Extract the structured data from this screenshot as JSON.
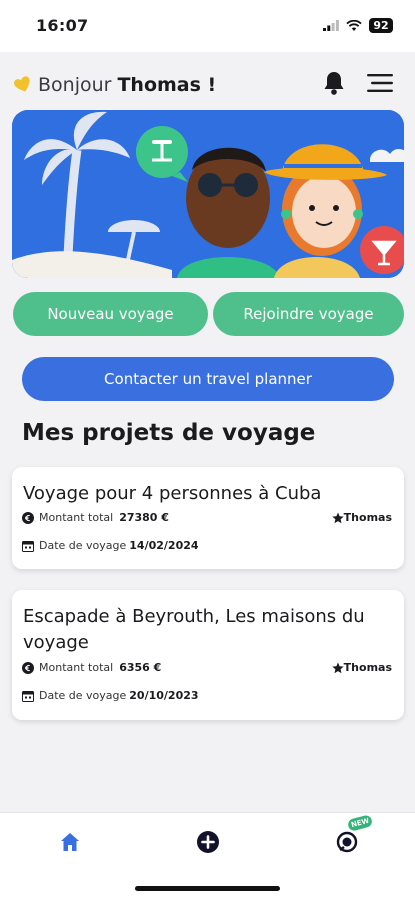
{
  "status": {
    "time": "16:07",
    "battery": "92"
  },
  "header": {
    "greeting": "Bonjour",
    "name": "Thomas !"
  },
  "actions": {
    "new_trip": "Nouveau voyage",
    "join_trip": "Rejoindre voyage",
    "contact_planner": "Contacter un travel planner"
  },
  "section_title": "Mes projets de voyage",
  "projects": [
    {
      "title": "Voyage pour 4 personnes à Cuba",
      "amount_label": "Montant total",
      "amount": "27380 €",
      "owner": "Thomas",
      "date_label": "Date de voyage",
      "date": "14/02/2024"
    },
    {
      "title": "Escapade à Beyrouth, Les maisons du voyage",
      "amount_label": "Montant total",
      "amount": "6356 €",
      "owner": "Thomas",
      "date_label": "Date de voyage",
      "date": "20/10/2023"
    }
  ],
  "nav": {
    "new_badge": "NEW"
  },
  "colors": {
    "primary_green": "#4fbf8c",
    "primary_blue": "#3a6fe0",
    "banner_blue": "#2f6fe0",
    "accent_yellow": "#f2c12e"
  },
  "icons": [
    "heart-icon",
    "bell-icon",
    "menu-icon",
    "euro-icon",
    "calendar-icon",
    "star-icon",
    "home-icon",
    "add-icon",
    "chat-icon"
  ]
}
